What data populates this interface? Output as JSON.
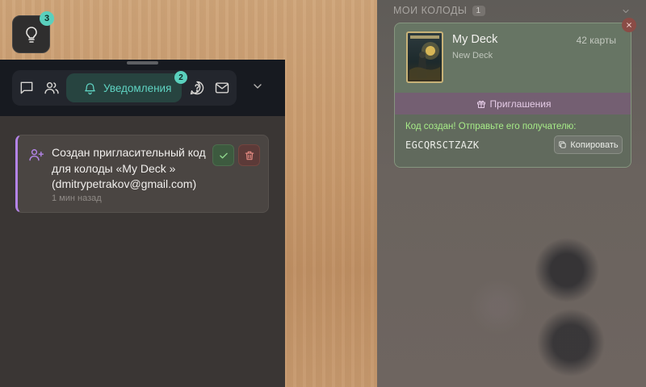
{
  "hint": {
    "badge": "3"
  },
  "toolbar": {
    "active_tab_label": "Уведомления",
    "active_tab_badge": "2",
    "icons": [
      "chat-icon",
      "users-icon",
      "bell-icon",
      "help-icon",
      "mail-icon",
      "chevron-down-icon"
    ]
  },
  "notifications": [
    {
      "text": "Создан пригласительный код для колоды «My Deck » (dmitrypetrakov@gmail.com)",
      "time": "1 мин назад"
    }
  ],
  "decks_panel": {
    "title": "МОИ КОЛОДЫ",
    "count": "1",
    "deck": {
      "name": "My Deck",
      "subtitle": "New Deck",
      "cards_count": "42 карты",
      "invite_label": "Приглашения",
      "code_message": "Код создан! Отправьте его получателю:",
      "code": "EGCQRSCTZAZK",
      "copy_label": "Копировать"
    }
  },
  "colors": {
    "accent_teal": "#5ad0bd",
    "notification_border": "#b484e8",
    "success_text": "#a7ec88"
  }
}
